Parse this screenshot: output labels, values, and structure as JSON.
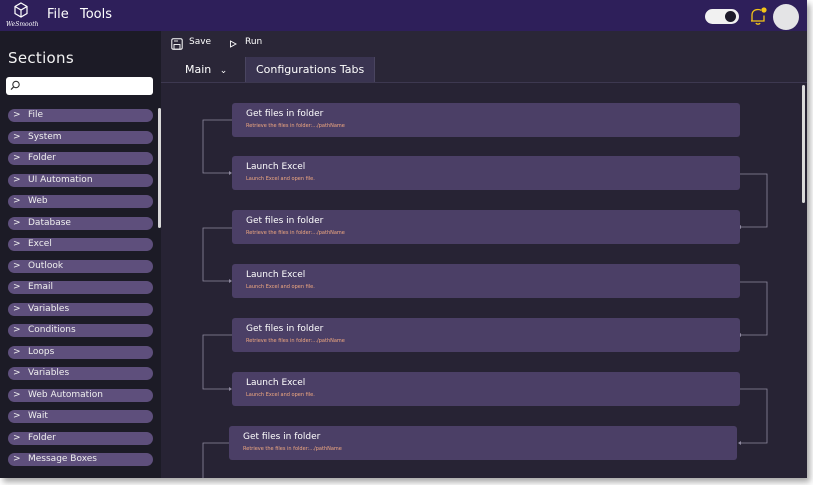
{
  "app": {
    "logo_text": "WeSmooth",
    "menu": [
      "File",
      "Tools"
    ]
  },
  "sidebar": {
    "title": "Sections",
    "search_placeholder": "",
    "items": [
      {
        "label": "File"
      },
      {
        "label": "System"
      },
      {
        "label": "Folder"
      },
      {
        "label": "UI Automation"
      },
      {
        "label": "Web"
      },
      {
        "label": "Database"
      },
      {
        "label": "Excel"
      },
      {
        "label": "Outlook"
      },
      {
        "label": "Email"
      },
      {
        "label": "Variables"
      },
      {
        "label": "Conditions"
      },
      {
        "label": "Loops"
      },
      {
        "label": "Variables"
      },
      {
        "label": "Web Automation"
      },
      {
        "label": "Wait"
      },
      {
        "label": "Folder"
      },
      {
        "label": "Message Boxes"
      }
    ]
  },
  "toolbar": {
    "save_label": "Save",
    "run_label": "Run"
  },
  "tabs": {
    "main_label": "Main",
    "config_label": "Configurations Tabs"
  },
  "flow": {
    "cards": [
      {
        "title": "Get files in folder",
        "desc": "Retrieve the files in folder:.../pathName"
      },
      {
        "title": "Launch Excel",
        "desc": "Launch Excel and open file."
      },
      {
        "title": "Get files in folder",
        "desc": "Retrieve the files in folder:.../pathName"
      },
      {
        "title": "Launch Excel",
        "desc": "Launch Excel and open file."
      },
      {
        "title": "Get files in folder",
        "desc": "Retrieve the files in folder:.../pathName"
      },
      {
        "title": "Launch Excel",
        "desc": "Launch Excel and open file."
      },
      {
        "title": "Get files in folder",
        "desc": "Retrieve the files in folder:.../pathName"
      }
    ]
  },
  "colors": {
    "topbar": "#2e1f5a",
    "sidebar_item": "#5e4f7c",
    "card": "#4b3f66",
    "desc_text": "#f0a880",
    "bell": "#f5c518"
  }
}
